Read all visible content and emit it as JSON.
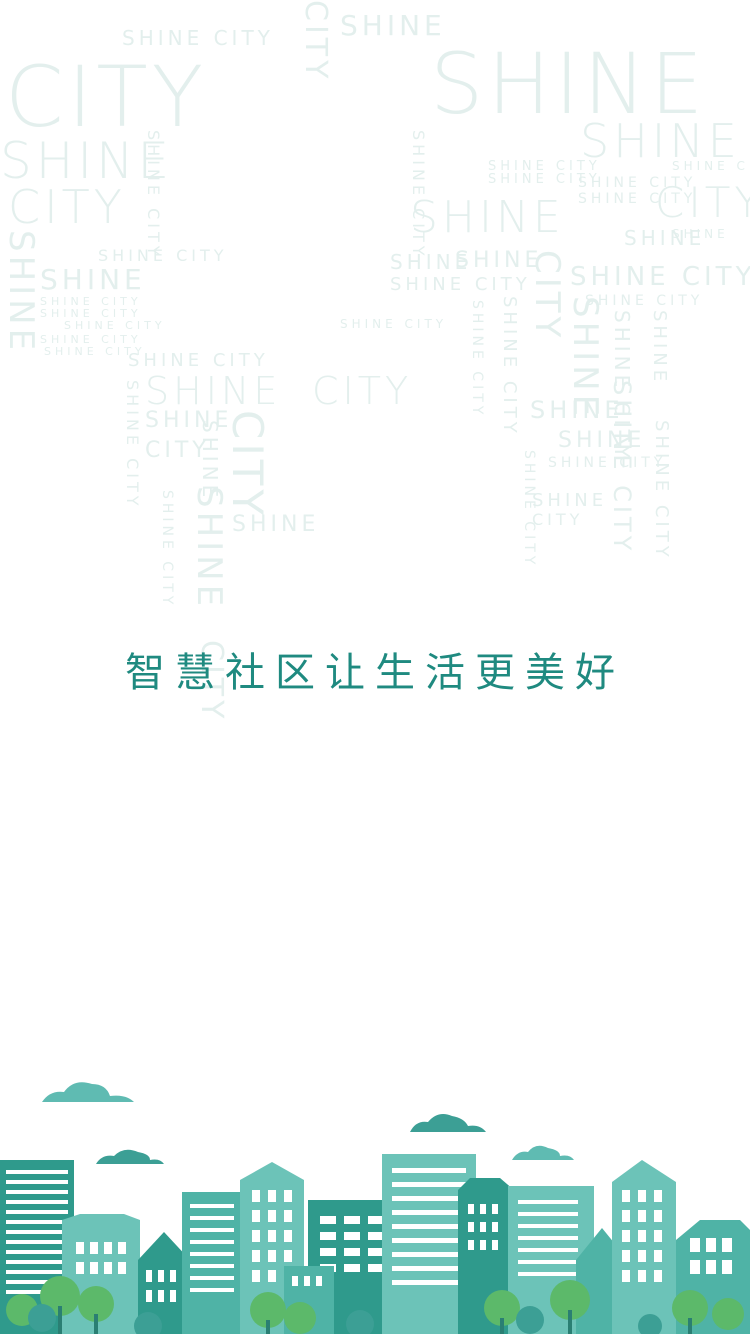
{
  "splash": {
    "slogan": "智慧社区让生活更美好"
  },
  "watermark": {
    "shine": "SHINE",
    "city": "CITY",
    "shine_city": "SHINE CITY"
  },
  "colors": {
    "slogan": "#1f8a80",
    "watermark": "#e3efed",
    "building_dark": "#2f9a8c",
    "building_mid": "#4fb3a6",
    "building_light": "#6cc3b8",
    "cloud": "#5fbbb2",
    "tree": "#5cb96a"
  }
}
